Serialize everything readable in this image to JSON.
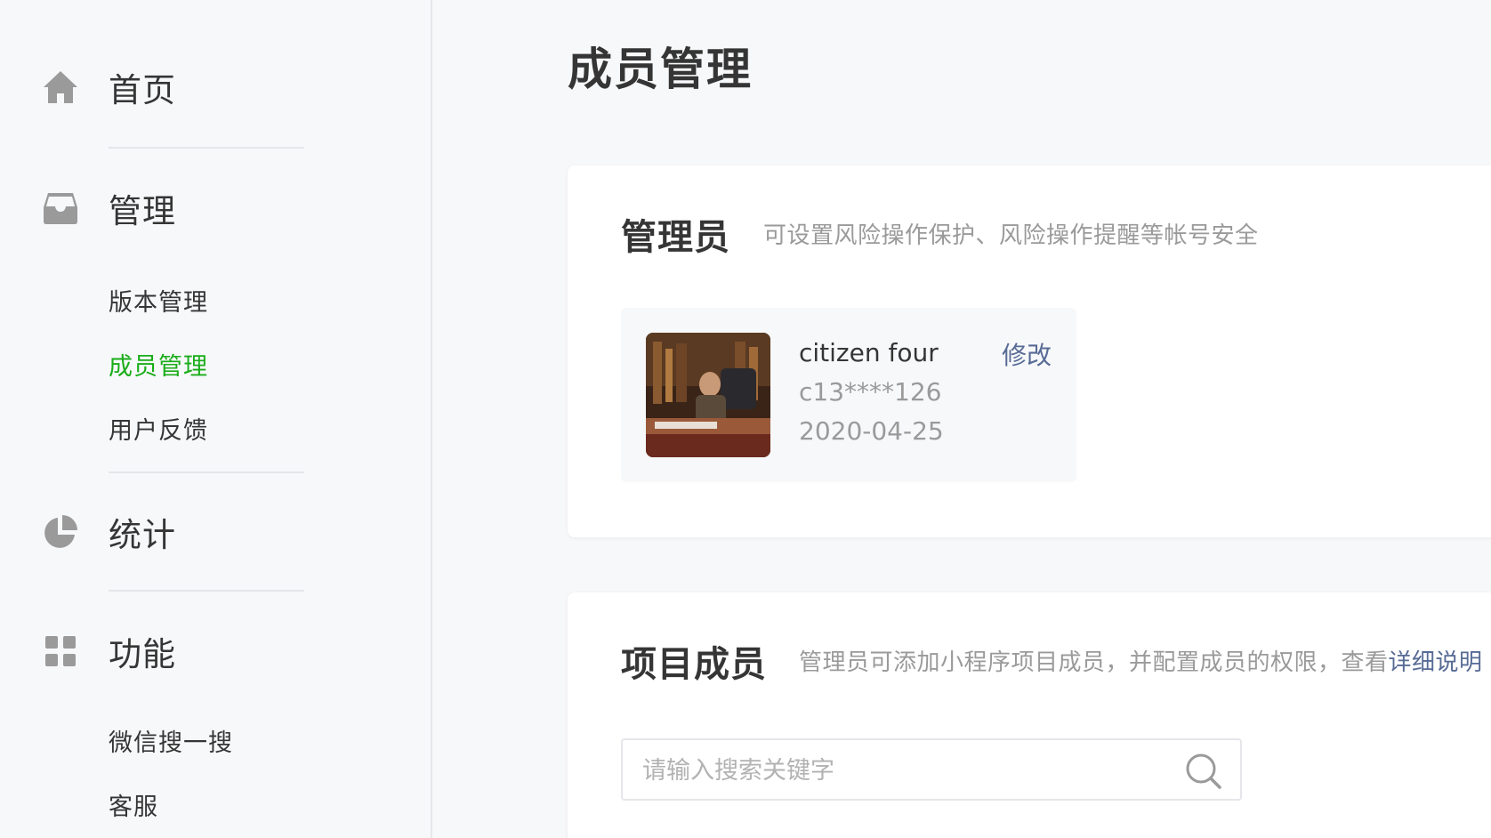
{
  "sidebar": {
    "home": {
      "label": "首页",
      "icon": "home-icon"
    },
    "manage": {
      "label": "管理",
      "icon": "inbox-icon",
      "items": [
        {
          "label": "版本管理",
          "active": false
        },
        {
          "label": "成员管理",
          "active": true
        },
        {
          "label": "用户反馈",
          "active": false
        }
      ]
    },
    "stats": {
      "label": "统计",
      "icon": "pie-chart-icon"
    },
    "features": {
      "label": "功能",
      "icon": "grid-icon",
      "items": [
        {
          "label": "微信搜一搜"
        },
        {
          "label": "客服"
        }
      ]
    }
  },
  "main": {
    "title": "成员管理",
    "admin_card": {
      "title": "管理员",
      "desc": "可设置风险操作保护、风险操作提醒等帐号安全",
      "admin": {
        "name": "citizen four",
        "phone": "c13****126",
        "date": "2020-04-25",
        "edit_label": "修改"
      }
    },
    "members_card": {
      "title": "项目成员",
      "desc": "管理员可添加小程序项目成员，并配置成员的权限，查看",
      "desc_link": "详细说明",
      "search_placeholder": "请输入搜索关键字"
    }
  },
  "colors": {
    "active": "#1aad19",
    "link": "#576b95",
    "icon": "#9a9a9a",
    "muted": "#9a9a9a",
    "background": "#f7f8fa"
  }
}
